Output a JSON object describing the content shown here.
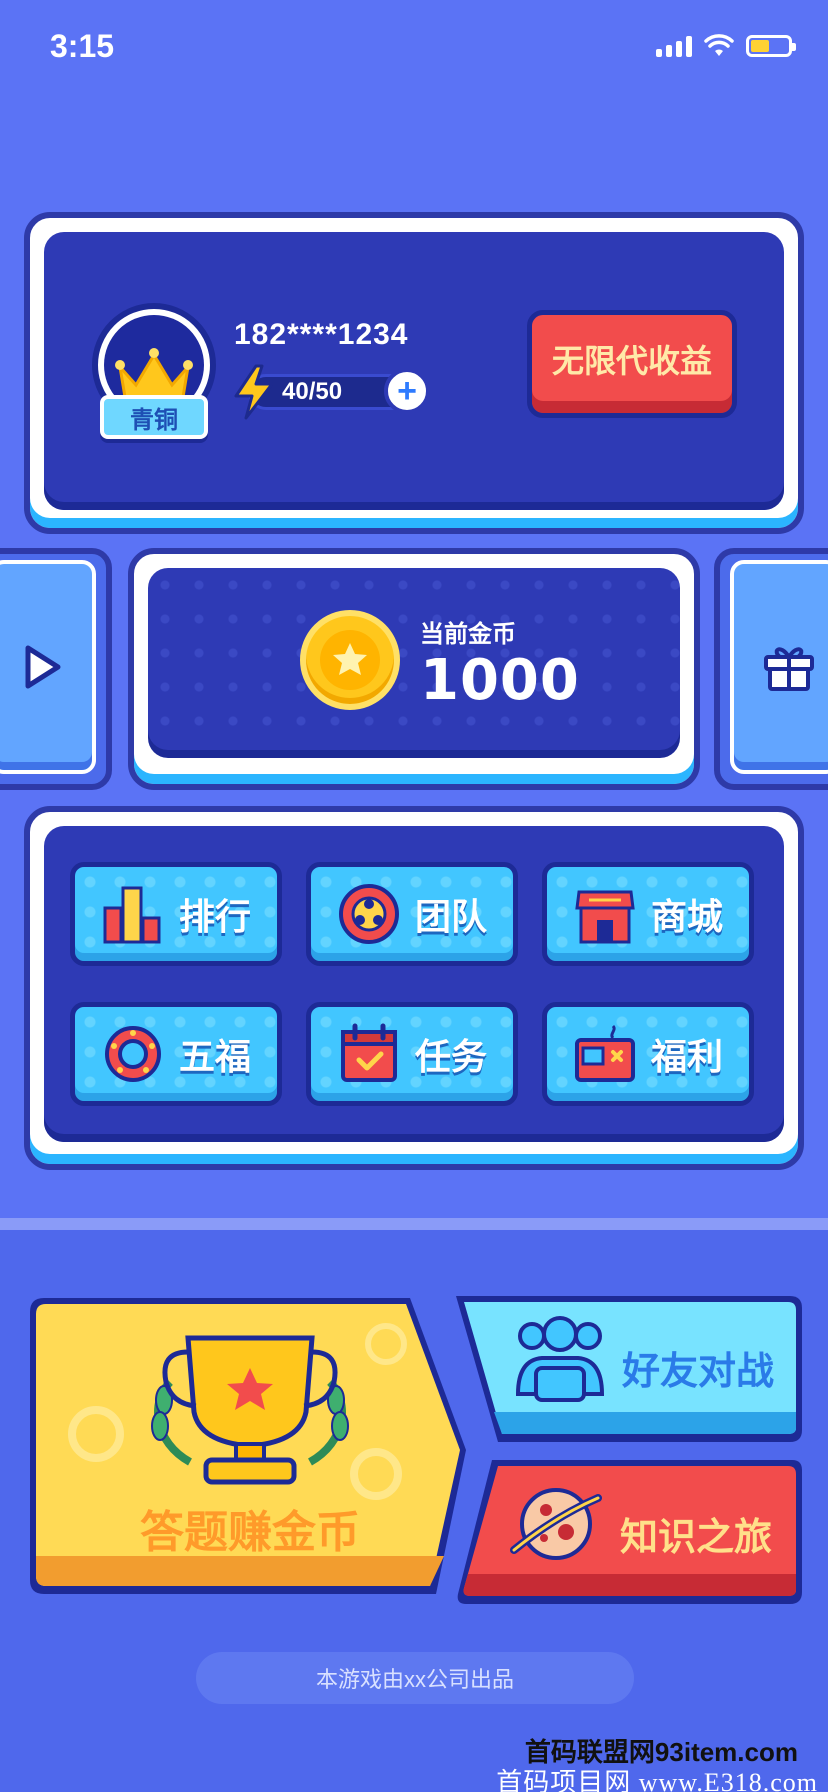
{
  "status_bar": {
    "time": "3:15"
  },
  "profile": {
    "phone": "182****1234",
    "rank": "青铜",
    "energy": "40/50",
    "plus_symbol": "+",
    "unlimited_button": "无限代收益"
  },
  "coins": {
    "label": "当前金币",
    "value": "1000"
  },
  "menu": {
    "items": [
      {
        "label": "排行",
        "icon": "bar-chart-icon"
      },
      {
        "label": "团队",
        "icon": "team-icon"
      },
      {
        "label": "商城",
        "icon": "shop-icon"
      },
      {
        "label": "五福",
        "icon": "ring-icon"
      },
      {
        "label": "任务",
        "icon": "calendar-icon"
      },
      {
        "label": "福利",
        "icon": "gift-box-icon"
      }
    ]
  },
  "games": {
    "quiz": "答题赚金币",
    "battle": "好友对战",
    "journey": "知识之旅"
  },
  "footer": {
    "text": "本游戏由xx公司出品"
  },
  "watermark": {
    "line1": "首码联盟网93item.com",
    "line2": "首码项目网 www.E318.com"
  },
  "colors": {
    "background": "#5B73F5",
    "panel": "#2E3AB5",
    "accent_red": "#F24C4C",
    "accent_yellow": "#FFD54A",
    "accent_cyan": "#42C6FF"
  }
}
